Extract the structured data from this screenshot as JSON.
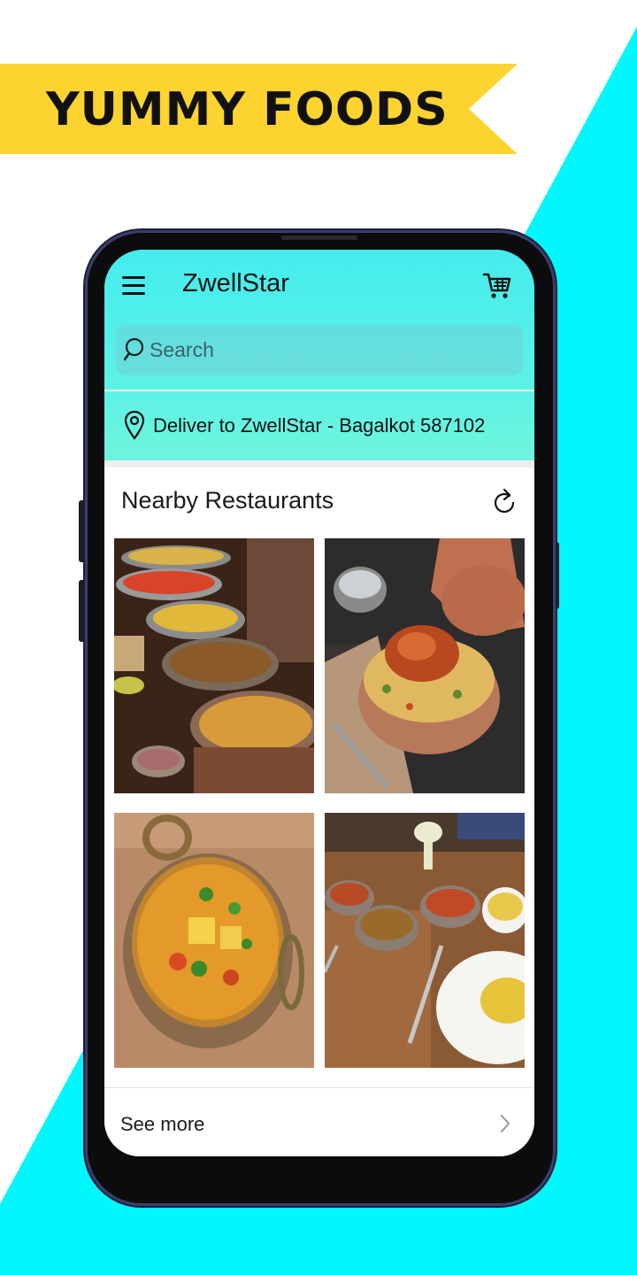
{
  "banner": {
    "title": "YUMMY FOODS"
  },
  "app": {
    "title": "ZwellStar",
    "search": {
      "placeholder": "Search"
    },
    "delivery": {
      "text": "Deliver to ZwellStar - Bagalkot 587102"
    },
    "nearby": {
      "title": "Nearby Restaurants",
      "see_more": "See more",
      "restaurants": [
        {
          "image": "food-buffet-image"
        },
        {
          "image": "biryani-chicken-image"
        },
        {
          "image": "paneer-curry-image"
        },
        {
          "image": "curry-table-image"
        }
      ]
    }
  },
  "colors": {
    "banner_yellow": "#fdd32f",
    "diagonal_cyan": "#00f7fb",
    "appbar_top": "#44ecee",
    "appbar_bottom": "#6ef5dd",
    "phone_frame": "#3a3f6a"
  }
}
